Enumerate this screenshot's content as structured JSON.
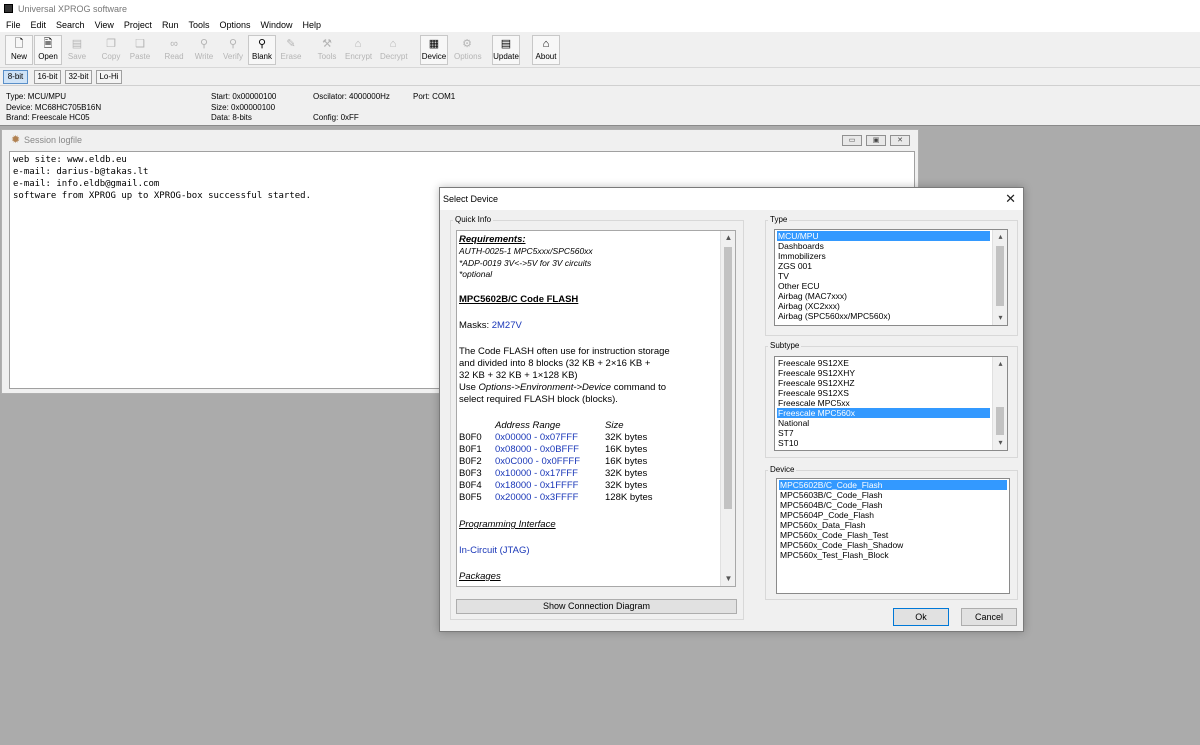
{
  "window": {
    "title": "Universal XPROG software"
  },
  "menu": [
    "File",
    "Edit",
    "Search",
    "View",
    "Project",
    "Run",
    "Tools",
    "Options",
    "Window",
    "Help"
  ],
  "toolbar": [
    {
      "label": "New",
      "icon": "new-file-icon",
      "glyph": "🗋",
      "enabled": true
    },
    {
      "label": "Open",
      "icon": "open-file-icon",
      "glyph": "🗎",
      "enabled": true
    },
    {
      "label": "Save",
      "icon": "save-icon",
      "glyph": "▤",
      "enabled": false
    },
    {
      "label": "Copy",
      "icon": "copy-icon",
      "glyph": "❐",
      "enabled": false
    },
    {
      "label": "Paste",
      "icon": "paste-icon",
      "glyph": "❑",
      "enabled": false
    },
    {
      "label": "Read",
      "icon": "read-icon",
      "glyph": "∞",
      "enabled": false
    },
    {
      "label": "Write",
      "icon": "write-icon",
      "glyph": "⚲",
      "enabled": false
    },
    {
      "label": "Verify",
      "icon": "verify-icon",
      "glyph": "⚲",
      "enabled": false
    },
    {
      "label": "Blank",
      "icon": "blank-check-icon",
      "glyph": "⚲",
      "enabled": true
    },
    {
      "label": "Erase",
      "icon": "erase-icon",
      "glyph": "✎",
      "enabled": false
    },
    {
      "label": "Tools",
      "icon": "tools-icon",
      "glyph": "⚒",
      "enabled": false
    },
    {
      "label": "Encrypt",
      "icon": "encrypt-icon",
      "glyph": "⌂",
      "enabled": false
    },
    {
      "label": "Decrypt",
      "icon": "decrypt-icon",
      "glyph": "⌂",
      "enabled": false
    },
    {
      "label": "Device",
      "icon": "device-chip-icon",
      "glyph": "▦",
      "enabled": true
    },
    {
      "label": "Options",
      "icon": "options-icon",
      "glyph": "⚙",
      "enabled": false
    },
    {
      "label": "Update",
      "icon": "update-icon",
      "glyph": "▤",
      "enabled": true
    },
    {
      "label": "About",
      "icon": "about-icon",
      "glyph": "⌂",
      "enabled": true
    }
  ],
  "modes": [
    "8-bit",
    "16-bit",
    "32-bit",
    "Lo-Hi"
  ],
  "info": {
    "type": "Type: MCU/MPU",
    "device": "Device: MC68HC705B16N",
    "brand": "Brand: Freescale HC05",
    "start": "Start: 0x00000100",
    "size": "Size: 0x00000100",
    "data": "Data: 8-bits",
    "oscilator": "Oscilator: 4000000Hz",
    "config": "Config: 0xFF",
    "port": "Port: COM1"
  },
  "log": {
    "title": "Session logfile",
    "lines": [
      "web site: www.eldb.eu",
      "e-mail: darius-b@takas.lt",
      "e-mail: info.eldb@gmail.com",
      "software from XPROG up to XPROG-box successful started."
    ]
  },
  "dialog": {
    "title": "Select Device",
    "quick_info_label": "Quick Info",
    "type_label": "Type",
    "subtype_label": "Subtype",
    "device_label": "Device",
    "show_diagram": "Show Connection Diagram",
    "ok": "Ok",
    "cancel": "Cancel",
    "qi": {
      "requirements": "Requirements:",
      "req1": "AUTH-0025-1 MPC5xxx/SPC560xx",
      "req2": "*ADP-0019 3V<->5V for 3V circuits",
      "req3": "*optional",
      "heading": "MPC5602B/C Code FLASH",
      "masks_label": "Masks:",
      "masks_value": "2M27V",
      "desc": [
        "The Code FLASH often use for instruction storage",
        "and divided into 8 blocks (32 KB + 2×16 KB +",
        "32 KB + 32 KB + 1×128 KB)"
      ],
      "desc_use": "Use ",
      "desc_cmd": "Options->Environment->Device",
      "desc_tail": " command to",
      "desc_last": "select required FLASH block (blocks).",
      "addr_header": "Address Range",
      "size_header": "Size",
      "blocks": [
        {
          "name": "B0F0",
          "range": "0x00000 - 0x07FFF",
          "size": "32K bytes"
        },
        {
          "name": "B0F1",
          "range": "0x08000 - 0x0BFFF",
          "size": "16K bytes"
        },
        {
          "name": "B0F2",
          "range": "0x0C000 - 0x0FFFF",
          "size": "16K bytes"
        },
        {
          "name": "B0F3",
          "range": "0x10000 - 0x17FFF",
          "size": "32K bytes"
        },
        {
          "name": "B0F4",
          "range": "0x18000 - 0x1FFFF",
          "size": "32K bytes"
        },
        {
          "name": "B0F5",
          "range": "0x20000 - 0x3FFFF",
          "size": "128K bytes"
        }
      ],
      "prog_iface": "Programming Interface",
      "in_circuit": "In-Circuit (JTAG)",
      "packages": "Packages"
    },
    "types": [
      "MCU/MPU",
      "Dashboards",
      "Immobilizers",
      "ZGS 001",
      "TV",
      "Other ECU",
      "Airbag (MAC7xxx)",
      "Airbag (XC2xxx)",
      "Airbag (SPC560xx/MPC560x)"
    ],
    "subtypes": [
      "Freescale 9S12XE",
      "Freescale 9S12XHY",
      "Freescale 9S12XHZ",
      "Freescale 9S12XS",
      "Freescale MPC5xx",
      "Freescale MPC560x",
      "National",
      "ST7",
      "ST10"
    ],
    "devices": [
      "MPC5602B/C_Code_Flash",
      "MPC5603B/C_Code_Flash",
      "MPC5604B/C_Code_Flash",
      "MPC5604P_Code_Flash",
      "MPC560x_Data_Flash",
      "MPC560x_Code_Flash_Test",
      "MPC560x_Code_Flash_Shadow",
      "MPC560x_Test_Flash_Block"
    ],
    "selected_type": "MCU/MPU",
    "selected_subtype": "Freescale MPC560x",
    "selected_device": "MPC5602B/C_Code_Flash"
  }
}
